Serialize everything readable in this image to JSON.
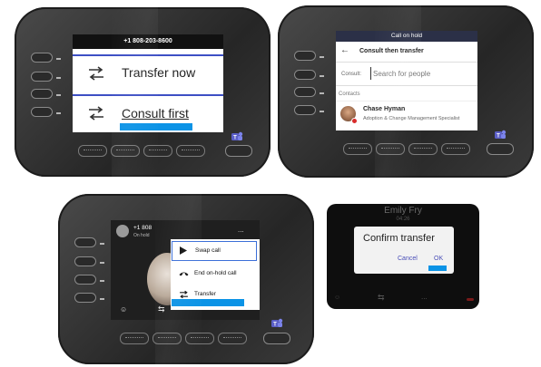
{
  "panel1": {
    "phone_number": "+1 808-203-8600",
    "transfer_now": "Transfer now",
    "consult_first": "Consult first",
    "icons": [
      "transfer-arrows-icon",
      "teams-icon"
    ]
  },
  "panel2": {
    "status": "Call on hold",
    "title": "Consult then transfer",
    "consult_label": "Consult:",
    "search_placeholder": "Search for people",
    "contacts_label": "Contacts",
    "contact_name": "Chase Hyman",
    "contact_title": "Adoption & Change Management Specialist",
    "icons": [
      "back-arrow-icon",
      "avatar",
      "teams-icon"
    ]
  },
  "panel3": {
    "caller_number": "+1 808",
    "caller_status": "On hold",
    "more": "...",
    "menu": [
      {
        "label": "Swap call",
        "icon": "play-icon"
      },
      {
        "label": "End on-hold call",
        "icon": "hangup-icon"
      },
      {
        "label": "Transfer",
        "icon": "transfer-arrows-icon"
      }
    ],
    "colors": {
      "highlight": "#0b93e6",
      "menu_border": "#3b6fd8"
    }
  },
  "panel4": {
    "caller_name": "Emily Fry",
    "call_time": "04:26",
    "dialog_title": "Confirm transfer",
    "cancel": "Cancel",
    "ok": "OK",
    "more": "..."
  }
}
